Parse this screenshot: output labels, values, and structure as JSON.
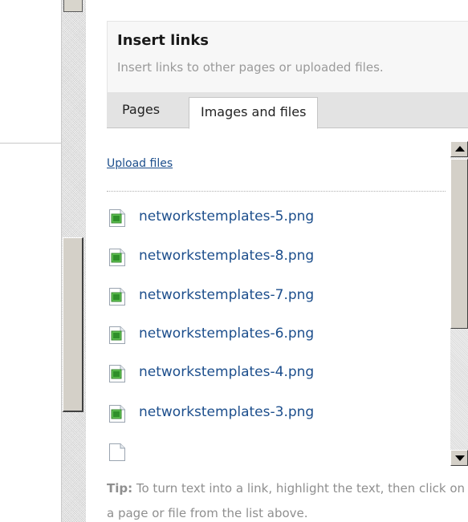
{
  "panel": {
    "title": "Insert links",
    "subtitle": "Insert links to other pages or uploaded files."
  },
  "tabs": [
    {
      "label": "Pages",
      "active": false
    },
    {
      "label": "Images and files",
      "active": true
    }
  ],
  "upload_link": "Upload files",
  "files": [
    {
      "name": "networkstemplates-5.png",
      "icon": "image-file-icon"
    },
    {
      "name": "networkstemplates-8.png",
      "icon": "image-file-icon"
    },
    {
      "name": "networkstemplates-7.png",
      "icon": "image-file-icon"
    },
    {
      "name": "networkstemplates-6.png",
      "icon": "image-file-icon"
    },
    {
      "name": "networkstemplates-4.png",
      "icon": "image-file-icon"
    },
    {
      "name": "networkstemplates-3.png",
      "icon": "image-file-icon"
    }
  ],
  "tip": {
    "label": "Tip:",
    "text": " To turn text into a link, highlight the text, then click on a page or file from the list above."
  },
  "colors": {
    "link": "#1c4e8c",
    "muted": "#9a9a9a",
    "tab_bar": "#e3e3e3",
    "header_bg": "#f7f7f7",
    "icon_green": "#3fa83a"
  }
}
